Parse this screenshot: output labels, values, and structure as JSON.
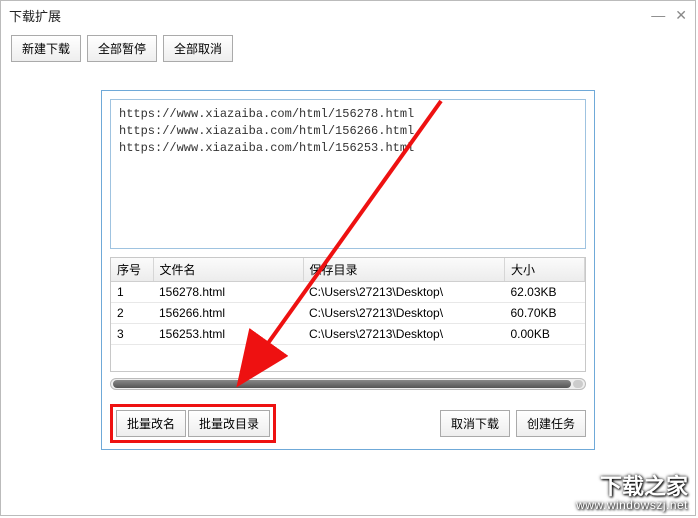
{
  "window": {
    "title": "下载扩展"
  },
  "toolbar": {
    "new_download": "新建下载",
    "pause_all": "全部暂停",
    "cancel_all": "全部取消"
  },
  "urls": [
    "https://www.xiazaiba.com/html/156278.html",
    "https://www.xiazaiba.com/html/156266.html",
    "https://www.xiazaiba.com/html/156253.html"
  ],
  "table": {
    "headers": {
      "index": "序号",
      "filename": "文件名",
      "save_dir": "保存目录",
      "size": "大小"
    },
    "rows": [
      {
        "index": "1",
        "filename": "156278.html",
        "save_dir": "C:\\Users\\27213\\Desktop\\",
        "size": "62.03KB"
      },
      {
        "index": "2",
        "filename": "156266.html",
        "save_dir": "C:\\Users\\27213\\Desktop\\",
        "size": "60.70KB"
      },
      {
        "index": "3",
        "filename": "156253.html",
        "save_dir": "C:\\Users\\27213\\Desktop\\",
        "size": "0.00KB"
      }
    ]
  },
  "buttons": {
    "batch_rename": "批量改名",
    "batch_change_dir": "批量改目录",
    "cancel_download": "取消下载",
    "create_task": "创建任务"
  },
  "watermark": {
    "line1": "下载之家",
    "line2": "www.windowszj.net"
  },
  "annotation": {
    "highlight_color": "#e11",
    "arrow_color": "#e11"
  }
}
